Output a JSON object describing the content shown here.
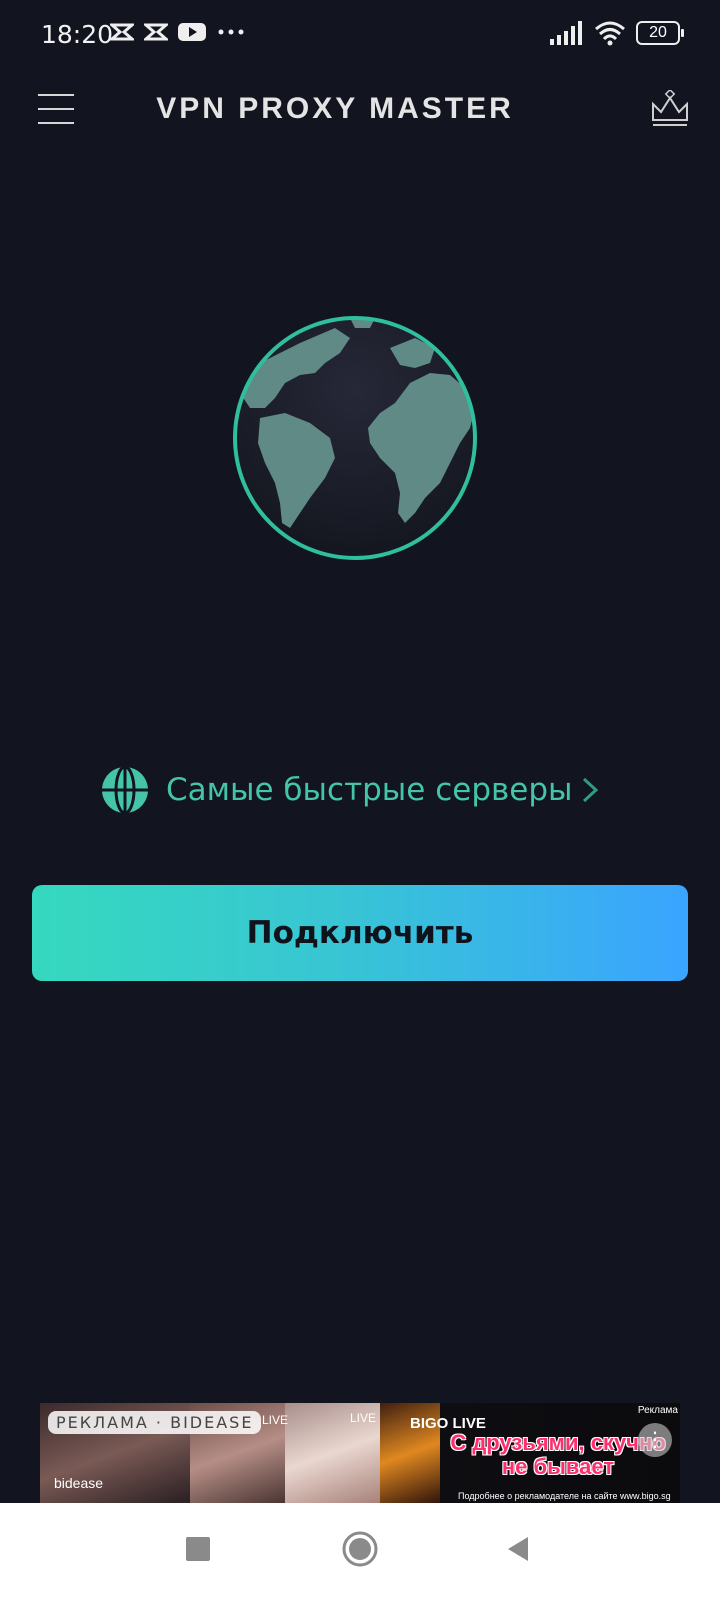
{
  "status_bar": {
    "time": "18:20",
    "battery": "20",
    "icons": [
      "capcut-icon",
      "capcut-icon",
      "youtube-icon",
      "more-dots-icon",
      "signal-icon",
      "wifi-icon",
      "battery-icon"
    ]
  },
  "header": {
    "title": "VPN PROXY MASTER",
    "menu_icon": "hamburger-menu-icon",
    "premium_icon": "crown-icon"
  },
  "globe": {
    "icon": "earth-globe-icon",
    "ring_color": "#2fbf9f"
  },
  "server_selector": {
    "label": "Самые быстрые серверы",
    "icon": "globe-icon",
    "chevron": "chevron-right-icon"
  },
  "connect_button": {
    "label": "Подключить"
  },
  "ad": {
    "label": "РЕКЛАМА · BIDEASE",
    "live1": "LIVE",
    "live2": "LIVE",
    "brand": "BIGO LIVE",
    "headline": "С друзьями, скучно не бывает",
    "disclaimer": "Подробнее о рекламодателе на сайте www.bigo.sg",
    "tag": "Реклама",
    "network": "bidease"
  },
  "nav_bar": {
    "icons": [
      "recent-apps-icon",
      "home-icon",
      "back-icon"
    ]
  },
  "colors": {
    "background": "#12141f",
    "accent": "#44c4a8",
    "button_gradient_start": "#35d9be",
    "button_gradient_end": "#3aa4ff"
  }
}
